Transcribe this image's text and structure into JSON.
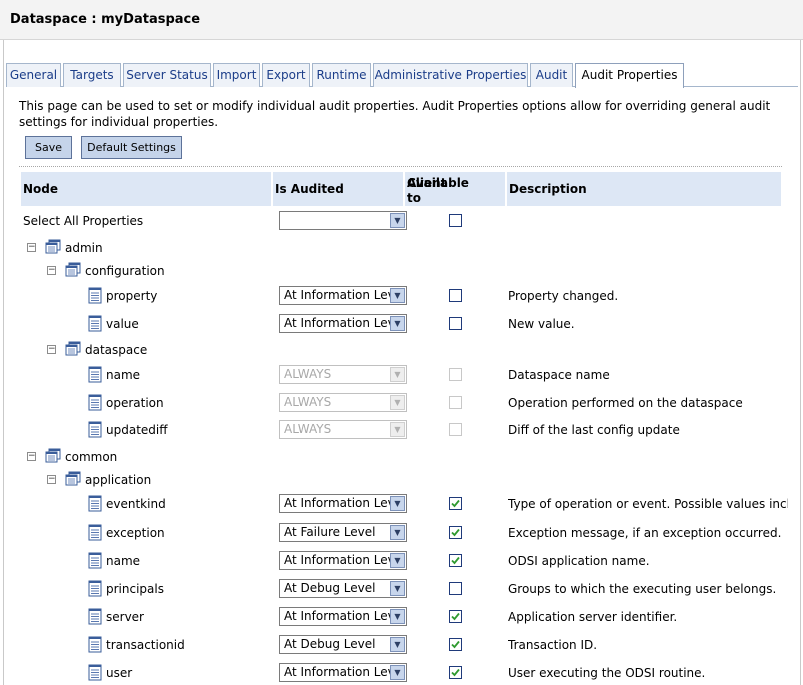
{
  "page": {
    "title": "Dataspace : myDataspace"
  },
  "tabs": [
    {
      "label": "General"
    },
    {
      "label": "Targets"
    },
    {
      "label": "Server Status"
    },
    {
      "label": "Import"
    },
    {
      "label": "Export"
    },
    {
      "label": "Runtime"
    },
    {
      "label": "Administrative Properties"
    },
    {
      "label": "Audit"
    },
    {
      "label": "Audit Properties"
    }
  ],
  "description": "This page can be used to set or modify individual audit properties. Audit Properties options allow for overriding general audit settings for individual properties.",
  "buttons": {
    "save": "Save",
    "default_settings": "Default Settings"
  },
  "table": {
    "headers": {
      "node": "Node",
      "is_audited": "Is Audited",
      "available_line1": "Available to",
      "available_line2": "Client",
      "description": "Description"
    },
    "select_all": {
      "label": "Select All Properties",
      "value": "",
      "checked": false
    },
    "rows": [
      {
        "type": "group",
        "level": 0,
        "label": "admin",
        "expanded": true
      },
      {
        "type": "group",
        "level": 1,
        "label": "configuration",
        "expanded": true
      },
      {
        "type": "leaf",
        "label": "property",
        "audit": "At Information Level",
        "checked": false,
        "disabled": false,
        "desc": "Property changed."
      },
      {
        "type": "leaf",
        "label": "value",
        "audit": "At Information Level",
        "checked": false,
        "disabled": false,
        "desc": "New value."
      },
      {
        "type": "group",
        "level": 1,
        "label": "dataspace",
        "expanded": true
      },
      {
        "type": "leaf",
        "label": "name",
        "audit": "ALWAYS",
        "checked": false,
        "disabled": true,
        "desc": "Dataspace name"
      },
      {
        "type": "leaf",
        "label": "operation",
        "audit": "ALWAYS",
        "checked": false,
        "disabled": true,
        "desc": "Operation performed on the dataspace"
      },
      {
        "type": "leaf",
        "label": "updatediff",
        "audit": "ALWAYS",
        "checked": false,
        "disabled": true,
        "desc": "Diff of the last config update"
      },
      {
        "type": "group",
        "level": 0,
        "label": "common",
        "expanded": true
      },
      {
        "type": "group",
        "level": 1,
        "label": "application",
        "expanded": true
      },
      {
        "type": "leaf",
        "label": "eventkind",
        "audit": "At Information Level",
        "checked": true,
        "disabled": false,
        "desc": "Type of operation or event. Possible values inclu"
      },
      {
        "type": "leaf",
        "label": "exception",
        "audit": "At Failure Level",
        "checked": true,
        "disabled": false,
        "desc": "Exception message, if an exception occurred."
      },
      {
        "type": "leaf",
        "label": "name",
        "audit": "At Information Level",
        "checked": true,
        "disabled": false,
        "desc": "ODSI application name."
      },
      {
        "type": "leaf",
        "label": "principals",
        "audit": "At Debug Level",
        "checked": false,
        "disabled": false,
        "desc": "Groups to which the executing user belongs."
      },
      {
        "type": "leaf",
        "label": "server",
        "audit": "At Information Level",
        "checked": true,
        "disabled": false,
        "desc": "Application server identifier."
      },
      {
        "type": "leaf",
        "label": "transactionid",
        "audit": "At Debug Level",
        "checked": true,
        "disabled": false,
        "desc": "Transaction ID."
      },
      {
        "type": "leaf",
        "label": "user",
        "audit": "At Information Level",
        "checked": true,
        "disabled": false,
        "desc": "User executing the ODSI routine."
      }
    ]
  },
  "icons": {
    "toggle": "collapse-minus-icon",
    "group": "folder-node-icon",
    "leaf": "property-document-icon",
    "dropdown": "dropdown-arrow-icon",
    "check": "checkmark-icon"
  },
  "colors": {
    "tab_text": "#1b3d89",
    "header_bg": "#dde7f5",
    "button_bg": "#c5d4ea",
    "check_green": "#2f9a2f"
  }
}
